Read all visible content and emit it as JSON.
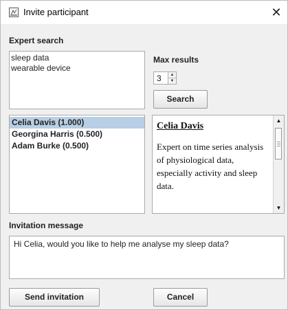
{
  "window": {
    "title": "Invite participant",
    "close_glyph": "✕"
  },
  "expert_search": {
    "heading": "Expert search",
    "query_text": "sleep data\nwearable device",
    "max_results_label": "Max results",
    "max_results_value": "3",
    "search_button": "Search"
  },
  "results": {
    "items": [
      {
        "label": "Celia Davis (1.000)",
        "selected": true
      },
      {
        "label": "Georgina Harris (0.500)",
        "selected": false
      },
      {
        "label": "Adam Burke (0.500)",
        "selected": false
      }
    ]
  },
  "detail": {
    "name": "Celia Davis",
    "description": "Expert on time series analysis of physiological data, especially activity and sleep data."
  },
  "invitation": {
    "heading": "Invitation message",
    "message": "Hi Celia, would you like to help me analyse my sleep data?"
  },
  "buttons": {
    "send": "Send invitation",
    "cancel": "Cancel"
  },
  "icons": {
    "app": "app-window-icon",
    "close": "close-icon",
    "spinner_up": "spinner-up-icon",
    "spinner_down": "spinner-down-icon",
    "scroll_up": "scroll-up-icon",
    "scroll_down": "scroll-down-icon"
  }
}
